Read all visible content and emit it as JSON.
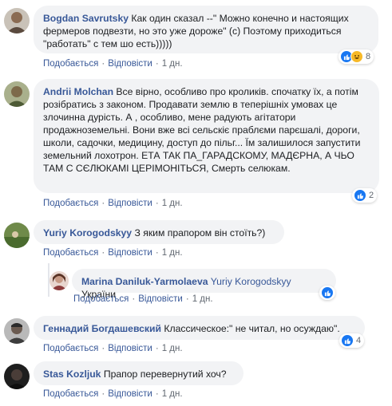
{
  "colors": {
    "link": "#385898",
    "bubble": "#f2f3f5",
    "meta": "#606770",
    "like": "#1877f2",
    "haha": "#f7b928"
  },
  "comments": [
    {
      "author": "Bogdan Savrutsky",
      "text": "Как один сказал --\" Можно конечно и настоящих фермеров подвезти, но это уже дороже\" (с) Поэтому приходиться \"работать\" с тем шо есть)))))",
      "like_label": "Подобається",
      "reply_label": "Відповісти",
      "time": "1 дн.",
      "reactions": [
        "like-icon",
        "haha-icon"
      ],
      "reaction_count": "8"
    },
    {
      "author": "Andrii Molchan",
      "text": "Все вірно, особливо про кроликів. спочатку їх, а потім розібратись з законом. Продавати землю в теперішніх умовах це злочинна дурість. А , особливо, мене радують агітатори продажноземельні. Вони вже всі сельскіє праблєми парєшалі, дороги, школи, садочки, медицину, доступ до пільг... Їм залишилося запустити земельний лохотрон. ЕТА ТАК ПА_ГАРАДСКОМУ, МАДЄРНА, А ЧЬО ТАМ С СЄЛЮКАМІ ЦЕРІМОНІТЬСЯ, Смерть селюкам.",
      "like_label": "Подобається",
      "reply_label": "Відповісти",
      "time": "1 дн.",
      "reactions": [
        "like-icon"
      ],
      "reaction_count": "2"
    },
    {
      "author": "Yuriy Korogodskyy",
      "text": "З яким прапором він стоїть?)",
      "like_label": "Подобається",
      "reply_label": "Відповісти",
      "time": "1 дн."
    },
    {
      "author": "Marina Daniluk-Yarmolaeva",
      "mention": "Yuriy Korogodskyy",
      "text": "України",
      "like_label": "Подобається",
      "reply_label": "Відповісти",
      "time": "1 дн.",
      "reactions": [
        "like-icon"
      ],
      "reaction_count": ""
    },
    {
      "author": "Геннадий Богдашевский",
      "text": "Классическое:\" не читал, но осуждаю\".",
      "like_label": "Подобається",
      "reply_label": "Відповісти",
      "time": "1 дн.",
      "reactions": [
        "like-icon"
      ],
      "reaction_count": "4"
    },
    {
      "author": "Stas Kozljuk",
      "text": "Прапор перевернутий хоч?",
      "like_label": "Подобається",
      "reply_label": "Відповісти",
      "time": "1 дн."
    }
  ]
}
